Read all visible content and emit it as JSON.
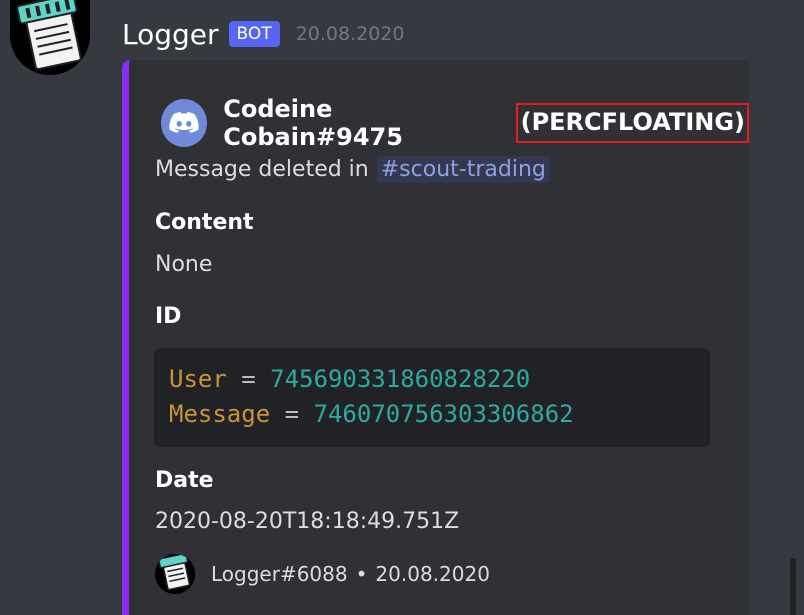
{
  "message": {
    "author": "Logger",
    "bot_tag": "BOT",
    "timestamp": "20.08.2020",
    "avatar_icon": "notepad-icon"
  },
  "embed": {
    "accent_color": "#8c2ef0",
    "author": {
      "icon": "discord-logo-icon",
      "name": "Codeine Cobain#9475",
      "highlighted": "(PERCFLOATING)"
    },
    "description": {
      "text": "Message deleted in",
      "channel": "#scout-trading"
    },
    "fields": {
      "content": {
        "name": "Content",
        "value": "None"
      },
      "id": {
        "name": "ID",
        "code": [
          {
            "key": "User",
            "eq": "=",
            "value": "745690331860828220"
          },
          {
            "key": "Message",
            "eq": "=",
            "value": "746070756303306862"
          }
        ]
      },
      "date": {
        "name": "Date",
        "value": "2020-08-20T18:18:49.751Z"
      }
    },
    "footer": {
      "icon": "notepad-icon",
      "text": "Logger#6088",
      "separator": "•",
      "date": "20.08.2020"
    }
  }
}
